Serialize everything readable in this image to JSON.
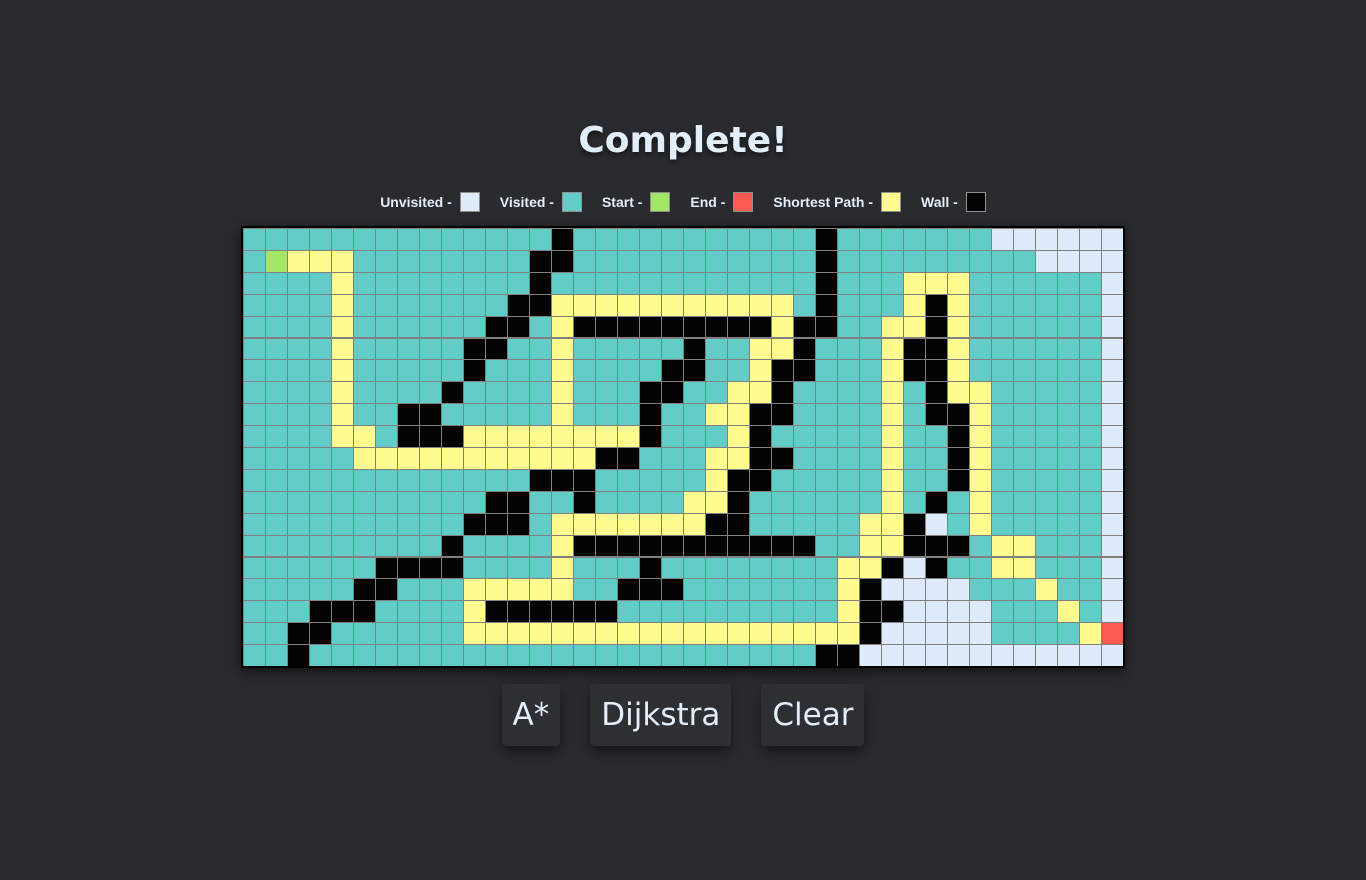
{
  "title": "Complete!",
  "legend": [
    {
      "label": "Unvisited -",
      "color": "#dfeafb",
      "key": "unvisited"
    },
    {
      "label": "Visited -",
      "color": "#62ccc7",
      "key": "visited"
    },
    {
      "label": "Start -",
      "color": "#a2e665",
      "key": "start"
    },
    {
      "label": "End -",
      "color": "#f85b51",
      "key": "end"
    },
    {
      "label": "Shortest Path -",
      "color": "#fefc8f",
      "key": "path"
    },
    {
      "label": "Wall -",
      "color": "#030303",
      "key": "wall"
    }
  ],
  "colors": {
    "U": "#dfeafb",
    "V": "#62ccc7",
    "S": "#a2e665",
    "E": "#f85b51",
    "P": "#fefc8f",
    "W": "#030303",
    "gridline": "#808080"
  },
  "grid": {
    "cols": 40,
    "rows": 20,
    "cells": [
      "VVVVVVVVVVVVVVWVVVVVVVVVVVWVVVVVVVUUUUUU",
      "VSPPPVVVVVVVVWWVVVVVVVVVVVWVVVVVVVVVUUUU",
      "VVVVPVVVVVVVVWVVVVVVVVVVVVWVVVPPPVVVVVVU",
      "VVVVPVVVVVVVWWPPPPPPPPPPPVWVVVPWPVVVVVVU",
      "VVVVPVVVVVVWWVPWWWWWWWWWPWWVVPPWPVVVVVVU",
      "VVVVPVVVVVWWVVPVVVVVWVVPPWVVVPWWPVVVVVVU",
      "VVVVPVVVVVWVVVPVVVVWWVVPWWVVVPWWPVVVVVVU",
      "VVVVPVVVVWVVVVPVVVWWVVPPWVVVVPVWPPVVVVVU",
      "VVVVPVVWWVVVVVPVVVWVVPPWWVVVVPVWWPVVVVVU",
      "VVVVPPVWWWPPPPPPPPWVVVPWVVVVVPVVWPVVVVVU",
      "VVVVVPPPPPPPPPPPWWVVVPPWWVVVVPVVWPVVVVVU",
      "VVVVVVVVVVVVVWWWVVVVVPWWVVVVVPVVWPVVVVVU",
      "VVVVVVVVVVVWWVVWVVVVPPWVVVVVVPVWVPVVVVVU",
      "VVVVVVVVVVWWWVPPPPPPPWWVVVVVPPWUVPVVVVVU",
      "VVVVVVVVVWVVVVPWWWWWWWWWWWVVPPWWWVPPVVVU",
      "VVVVVVWWWWVVVVPVVVWVVVVVVVVPPWUWVVPPVVVU",
      "VVVVVWWVVVPPPPPVVWWWVVVVVVVPWUUUUVVVPVVU",
      "VVVWWWVVVVPWWWWWWVVVVVVVVVVPWWUUUUVVVPVU",
      "VVWWVVVVVVPPPPPPPPPPPPPPPPPPWUUUUUVVVVPEU",
      "VVWVVVVVVVVVVVVVVVVVVVVVVVWWUUUUUUUUUUUUU"
    ]
  },
  "buttons": {
    "astar": "A*",
    "dijkstra": "Dijkstra",
    "clear": "Clear"
  }
}
